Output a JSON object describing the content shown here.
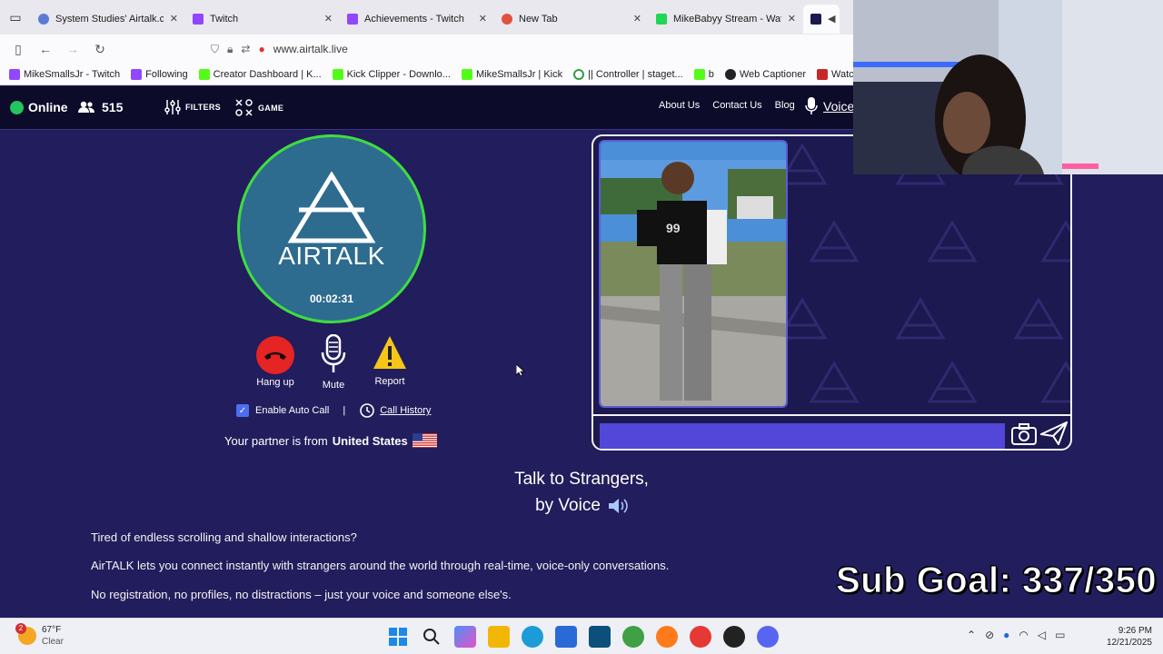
{
  "browser": {
    "tabs": [
      {
        "title": "System Studies' Airtalk.com",
        "color": "#5b7bd5",
        "active": false
      },
      {
        "title": "Twitch",
        "color": "#9146ff",
        "active": false
      },
      {
        "title": "Achievements - Twitch",
        "color": "#9146ff",
        "active": false
      },
      {
        "title": "New Tab",
        "color": "#e0533d",
        "active": false
      },
      {
        "title": "MikeBabyy Stream - Watch",
        "color": "#1fd655",
        "active": false
      }
    ],
    "url": "www.airtalk.live",
    "bookmarks": [
      {
        "label": "MikeSmallsJr - Twitch",
        "color": "#9146ff"
      },
      {
        "label": "Following",
        "color": "#9146ff"
      },
      {
        "label": "Creator Dashboard | K...",
        "color": "#53fc18"
      },
      {
        "label": "Kick Clipper - Downlo...",
        "color": "#53fc18"
      },
      {
        "label": "MikeSmallsJr | Kick",
        "color": "#53fc18"
      },
      {
        "label": "|| Controller | staget...",
        "color": "#2ea043"
      },
      {
        "label": "b",
        "color": "#53fc18"
      },
      {
        "label": "Web Captioner",
        "color": "#222222"
      },
      {
        "label": "Watch movie Obses",
        "color": "#c62828"
      }
    ]
  },
  "site": {
    "online_label": "Online",
    "user_count": "515",
    "filters_label": "FILTERS",
    "game_label": "GAME",
    "nav_links": [
      "About Us",
      "Contact Us",
      "Blog"
    ],
    "voice_label": "Voice",
    "logo_text": "AIRTALK",
    "timer": "00:02:31",
    "controls": {
      "hangup": "Hang up",
      "mute": "Mute",
      "report": "Report"
    },
    "auto_call_label": "Enable Auto Call",
    "separator": "|",
    "call_history_label": "Call History",
    "partner_prefix": "Your partner is from",
    "partner_country": "United States",
    "headline_line1": "Talk to Strangers,",
    "headline_line2": "by Voice",
    "paragraphs": [
      "Tired of endless scrolling and shallow interactions?",
      "AirTALK lets you connect instantly with strangers around the world through real-time, voice-only conversations.",
      "No registration, no profiles, no distractions – just your voice and someone else's."
    ]
  },
  "overlay": {
    "sub_goal": "Sub Goal: 337/350"
  },
  "taskbar": {
    "weather_temp": "67°F",
    "weather_desc": "Clear",
    "weather_badge": "2",
    "time": "9:26 PM",
    "date": "12/21/2025"
  },
  "colors": {
    "page_bg": "#221d5c",
    "header_bg": "#0d0b2a",
    "online_green": "#22c55e",
    "logo_ring": "#3fdc3f",
    "hangup_red": "#e52424",
    "report_yellow": "#f5c518",
    "chat_input": "#5247d8"
  }
}
